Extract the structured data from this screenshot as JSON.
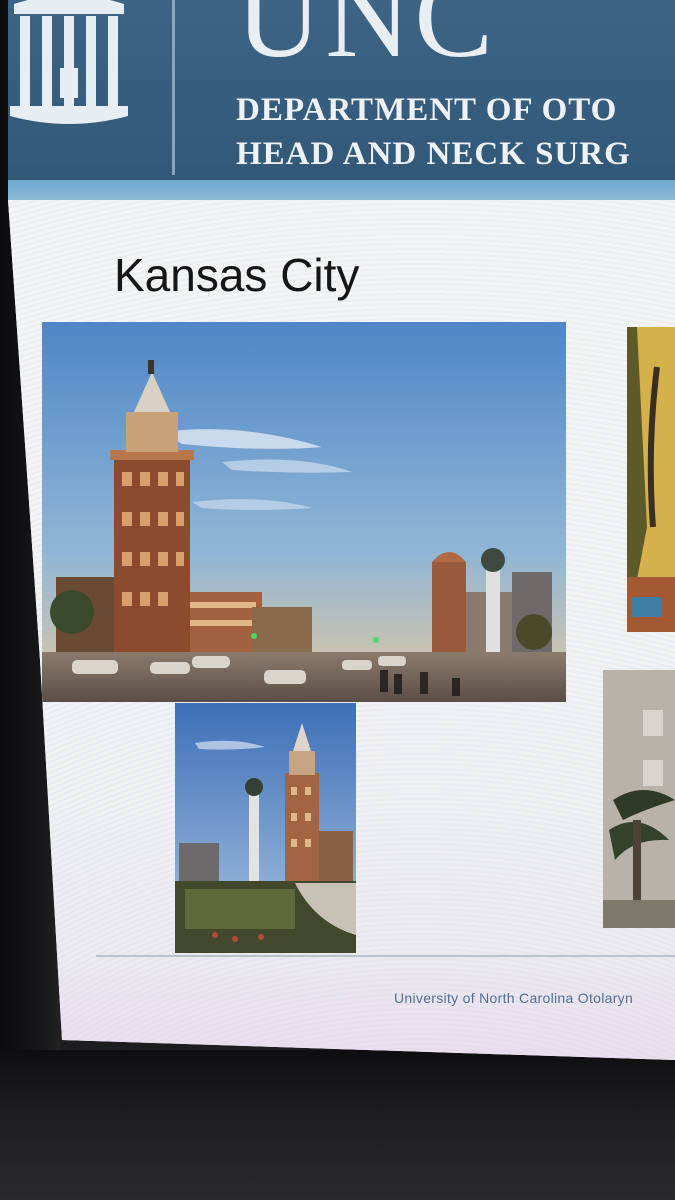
{
  "banner": {
    "logo_text": "UNC",
    "department_line1": "DEPARTMENT OF OTO",
    "department_line2": "HEAD AND NECK SURG",
    "logo_icon": "old-well-icon"
  },
  "slide": {
    "title": "Kansas City",
    "footer": "University of North Carolina Otolaryn"
  },
  "photos": [
    {
      "id": "main",
      "subject": "plaza-tower-street-photo"
    },
    {
      "id": "small",
      "subject": "plaza-tower-fountain-photo"
    },
    {
      "id": "right-top",
      "subject": "cropped-photo"
    },
    {
      "id": "right-bottom",
      "subject": "cropped-photo"
    }
  ],
  "colors": {
    "banner": "#3d6485",
    "stripe": "#6ea7cf",
    "footer_text": "#3f6688"
  }
}
